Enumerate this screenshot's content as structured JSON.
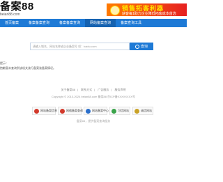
{
  "logo": {
    "text": "备案88",
    "domain": "beian88.com"
  },
  "banner": {
    "title": "销售拓客利器",
    "subtitle": "获客每1助力企业降低拓客成本首选"
  },
  "nav": [
    "首页备案",
    "备案备案查询",
    "备案备案查询",
    "网站备案查询",
    "备案查询工具"
  ],
  "search": {
    "placeholder": "请输入域名、网站名称或企业备案号 如：baidu.com",
    "button_label": "查询"
  },
  "result": {
    "line1": "提示：",
    "line2": "抱歉暂未查询到该机关该行备案该备案情况。"
  },
  "footer": {
    "links": [
      "关于备案88",
      "联系方式",
      "广告服务",
      "服务声明"
    ],
    "copyright": "Copyright © 2013-2024 beian88.com 备案88 京ICP备XXXXXXXX号"
  },
  "badges": [
    "网站备案信息",
    "网络备案查询",
    "网站备案中心",
    "可信网站",
    "诚信网站"
  ],
  "note": "备案88，提供备案查询服务"
}
